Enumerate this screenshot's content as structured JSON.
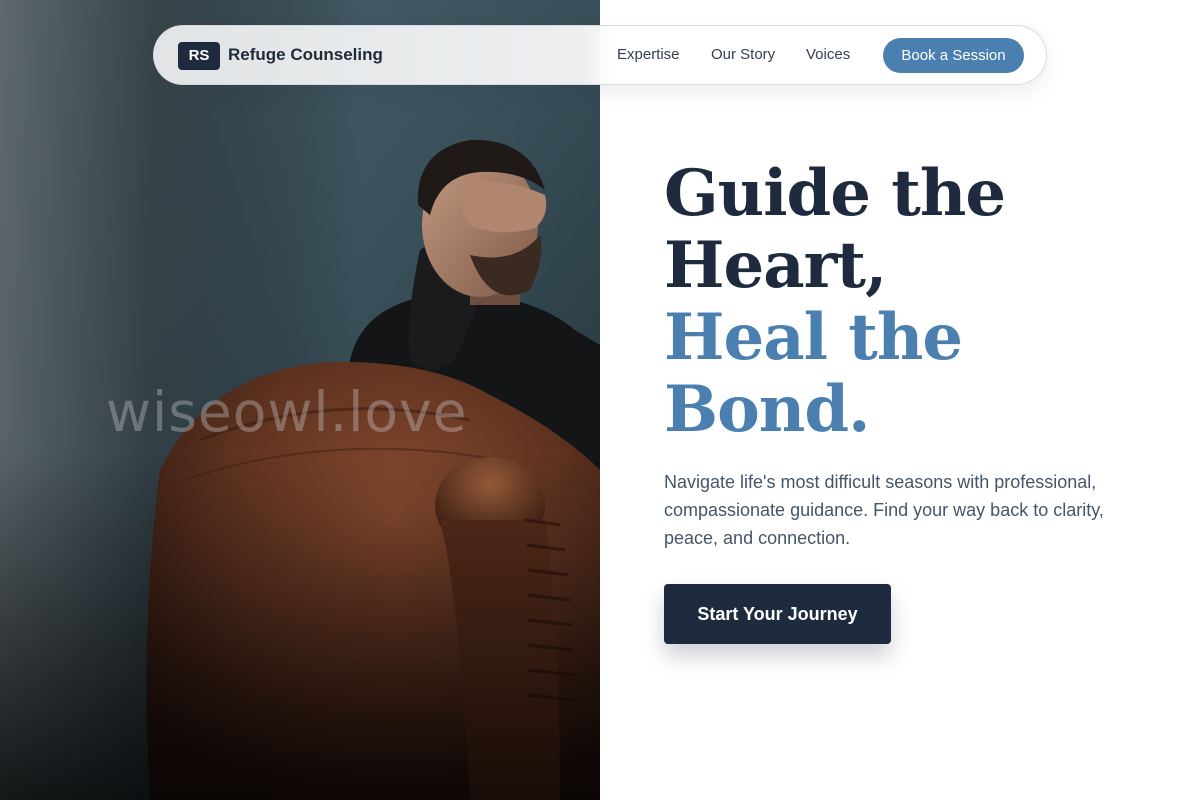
{
  "brand": {
    "badge": "RS",
    "name": "Refuge Counseling"
  },
  "nav": {
    "links": [
      "Expertise",
      "Our Story",
      "Voices"
    ],
    "cta_label": "Book a Session"
  },
  "hero": {
    "title_lines": [
      "Guide the",
      "Heart,"
    ],
    "title_accent_lines": [
      "Heal the",
      "Bond."
    ],
    "description": "Navigate life's most difficult seasons with professional, compassionate guidance. Find your way back to clarity, peace, and connection.",
    "cta_label": "Start Your Journey",
    "image_subject": "man-with-hand-over-face-behind-leather-armchair"
  },
  "watermark": "wiseowl.love",
  "colors": {
    "navy": "#1e2a3e",
    "accent_blue": "#4a7fb0",
    "body_text": "#475569",
    "background": "#ffffff"
  },
  "icons": {
    "logo": "rs-monogram-badge"
  }
}
